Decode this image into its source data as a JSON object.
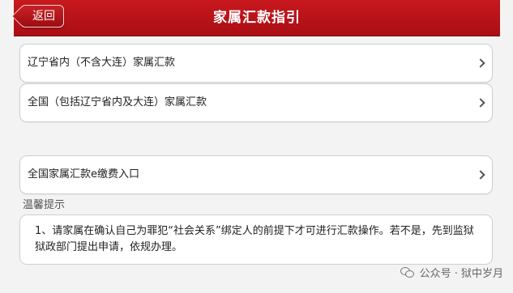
{
  "header": {
    "back_label": "返回",
    "title": "家属汇款指引"
  },
  "menu": {
    "items": [
      {
        "label": "辽宁省内（不含大连）家属汇款"
      },
      {
        "label": "全国（包括辽宁省内及大连）家属汇款"
      },
      {
        "label": "全国家属汇款e缴费入口"
      }
    ]
  },
  "tips": {
    "title": "温馨提示",
    "text": "1、请家属在确认自己为罪犯“社会关系”绑定人的前提下才可进行汇款操作。若不是，先到监狱狱政部门提出申请，依规办理。"
  },
  "watermark": {
    "text": "公众号 · 狱中岁月"
  }
}
